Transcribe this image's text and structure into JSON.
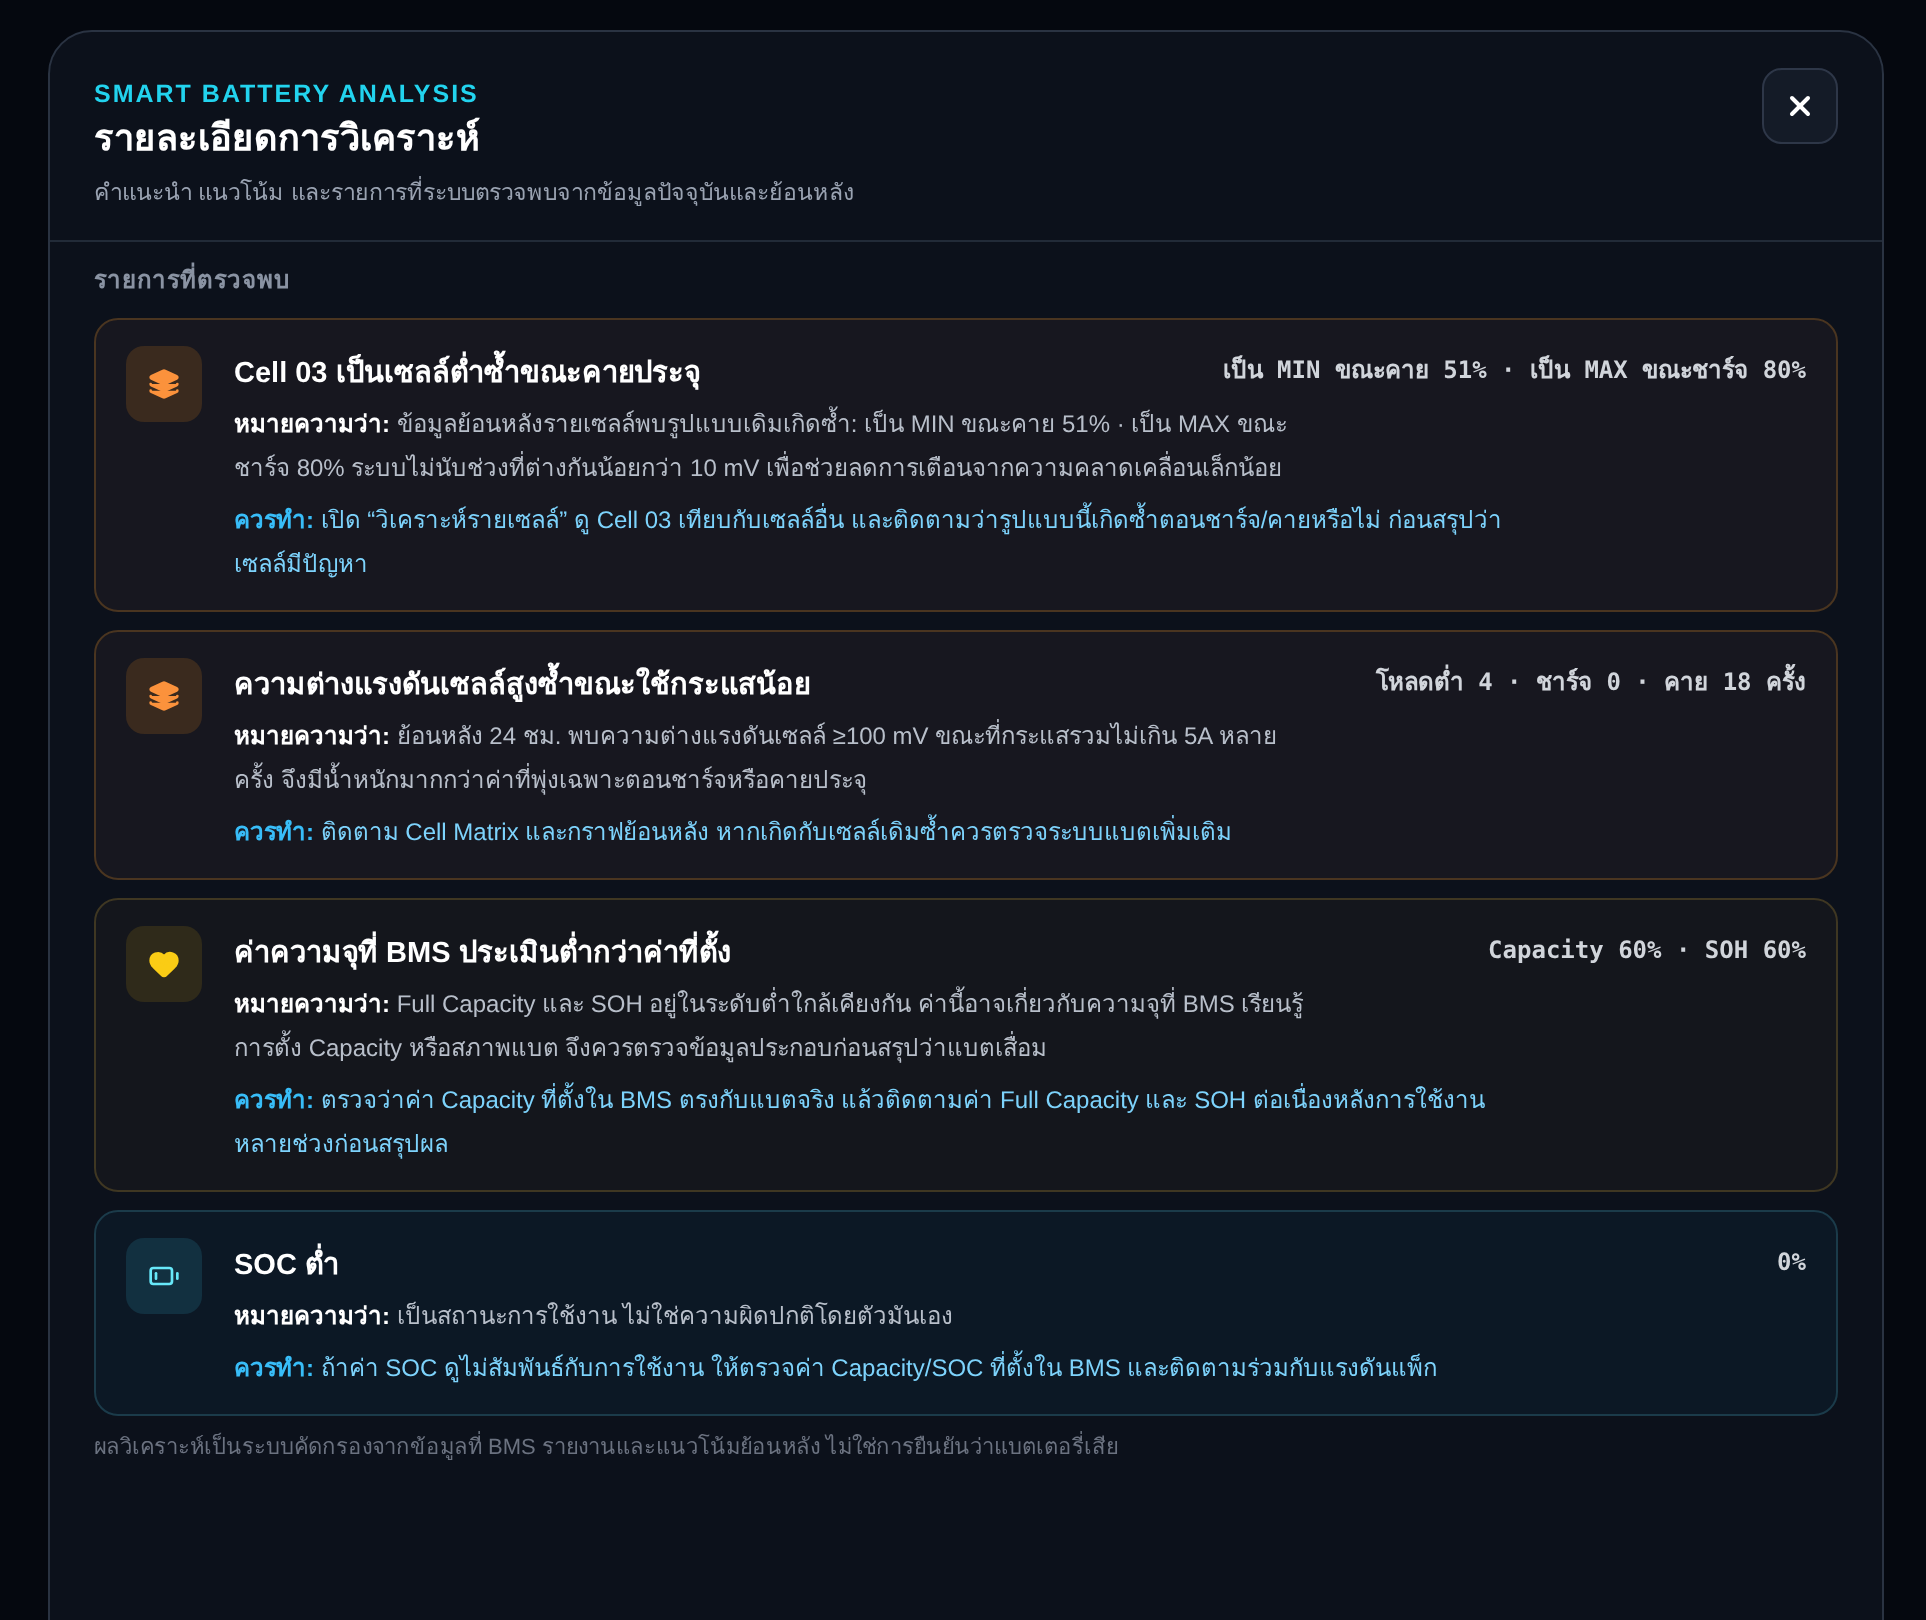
{
  "dialog": {
    "eyebrow": "SMART BATTERY ANALYSIS",
    "title": "รายละเอียดการวิเคราะห์",
    "subtitle": "คำแนะนำ แนวโน้ม และรายการที่ระบบตรวจพบจากข้อมูลปัจจุบันและย้อนหลัง"
  },
  "section_title": "รายการที่ตรวจพบ",
  "findings": [
    {
      "kind": "cell",
      "title": "Cell 03 เป็นเซลล์ต่ำซ้ำขณะคายประจุ",
      "meta": "เป็น MIN ขณะคาย 51% · เป็น MAX ขณะชาร์จ 80%",
      "meaning_label": "หมายความว่า:",
      "meaning": "ข้อมูลย้อนหลังรายเซลล์พบรูปแบบเดิมเกิดซ้ำ: เป็น MIN ขณะคาย 51% · เป็น MAX ขณะชาร์จ 80% ระบบไม่นับช่วงที่ต่างกันน้อยกว่า 10 mV เพื่อช่วยลดการเตือนจากความคลาดเคลื่อนเล็กน้อย",
      "action_label": "ควรทำ:",
      "action": "เปิด “วิเคราะห์รายเซลล์” ดู Cell 03 เทียบกับเซลล์อื่น และติดตามว่ารูปแบบนี้เกิดซ้ำตอนชาร์จ/คายหรือไม่ ก่อนสรุปว่าเซลล์มีปัญหา"
    },
    {
      "kind": "cell",
      "title": "ความต่างแรงดันเซลล์สูงซ้ำขณะใช้กระแสน้อย",
      "meta": "โหลดต่ำ 4 · ชาร์จ 0 · คาย 18 ครั้ง",
      "meaning_label": "หมายความว่า:",
      "meaning": "ย้อนหลัง 24 ชม. พบความต่างแรงดันเซลล์ ≥100 mV ขณะที่กระแสรวมไม่เกิน 5A หลายครั้ง จึงมีน้ำหนักมากกว่าค่าที่พุ่งเฉพาะตอนชาร์จหรือคายประจุ",
      "action_label": "ควรทำ:",
      "action": "ติดตาม Cell Matrix และกราฟย้อนหลัง หากเกิดกับเซลล์เดิมซ้ำควรตรวจระบบแบตเพิ่มเติม"
    },
    {
      "kind": "capacity",
      "title": "ค่าความจุที่ BMS ประเมินต่ำกว่าค่าที่ตั้ง",
      "meta": "Capacity 60% · SOH 60%",
      "meaning_label": "หมายความว่า:",
      "meaning": "Full Capacity และ SOH อยู่ในระดับต่ำใกล้เคียงกัน ค่านี้อาจเกี่ยวกับความจุที่ BMS เรียนรู้ การตั้ง Capacity หรือสภาพแบต จึงควรตรวจข้อมูลประกอบก่อนสรุปว่าแบตเสื่อม",
      "action_label": "ควรทำ:",
      "action": "ตรวจว่าค่า Capacity ที่ตั้งใน BMS ตรงกับแบตจริง แล้วติดตามค่า Full Capacity และ SOH ต่อเนื่องหลังการใช้งานหลายช่วงก่อนสรุปผล"
    },
    {
      "kind": "soc",
      "title": "SOC ต่ำ",
      "meta": "0%",
      "meaning_label": "หมายความว่า:",
      "meaning": "เป็นสถานะการใช้งาน ไม่ใช่ความผิดปกติโดยตัวมันเอง",
      "action_label": "ควรทำ:",
      "action": "ถ้าค่า SOC ดูไม่สัมพันธ์กับการใช้งาน ให้ตรวจค่า Capacity/SOC ที่ตั้งใน BMS และติดตามร่วมกับแรงดันแพ็ก"
    }
  ],
  "footer_note": "ผลวิเคราะห์เป็นระบบคัดกรองจากข้อมูลที่ BMS รายงานและแนวโน้มย้อนหลัง ไม่ใช่การยืนยันว่าแบตเตอรี่เสีย"
}
